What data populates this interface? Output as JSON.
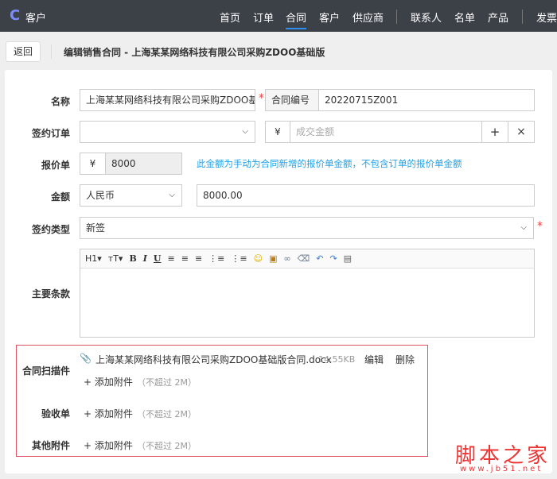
{
  "app": {
    "name": "客户",
    "nav": [
      "首页",
      "订单",
      "合同",
      "客户",
      "供应商",
      "联系人",
      "名单",
      "产品",
      "发票"
    ]
  },
  "header": {
    "back": "返回",
    "title": "编辑销售合同 - 上海某某网络科技有限公司采购ZDOO基础版"
  },
  "form": {
    "name_label": "名称",
    "name_value": "上海某某网络科技有限公司采购ZDOO基础版",
    "required": "*",
    "code_label": "合同编号",
    "code_value": "20220715Z001",
    "order_label": "签约订单",
    "currency_symbol": "¥",
    "amount_placeholder": "成交金额",
    "plus": "+",
    "times": "×",
    "quote_label": "报价单",
    "quote_value": "8000",
    "quote_info": "此金额为手动为合同新增的报价单金额，不包含订单的报价单金额",
    "money_label": "金额",
    "currency": "人民币",
    "money_value": "8000.00",
    "type_label": "签约类型",
    "type_value": "新签",
    "terms_label": "主要条款",
    "toolbar": [
      "H1▾",
      "тT▾",
      "B",
      "I",
      "U",
      "≡",
      "≡",
      "≡",
      "⋮≡",
      "⋮≡",
      "☺",
      "▣",
      "∞",
      "⌫",
      "↶",
      "↷",
      "▤"
    ]
  },
  "attachments": {
    "scan_label": "合同扫描件",
    "file_name": "上海某某网络科技有限公司采购ZDOO基础版合同.docx",
    "file_size": "14.55KB",
    "edit": "编辑",
    "delete": "删除",
    "add": "+ 添加附件",
    "limit": "（不超过 2M）",
    "acceptance_label": "验收单",
    "other_label": "其他附件"
  },
  "watermark": {
    "text": "脚本之家",
    "url": "www.jb51.net"
  }
}
